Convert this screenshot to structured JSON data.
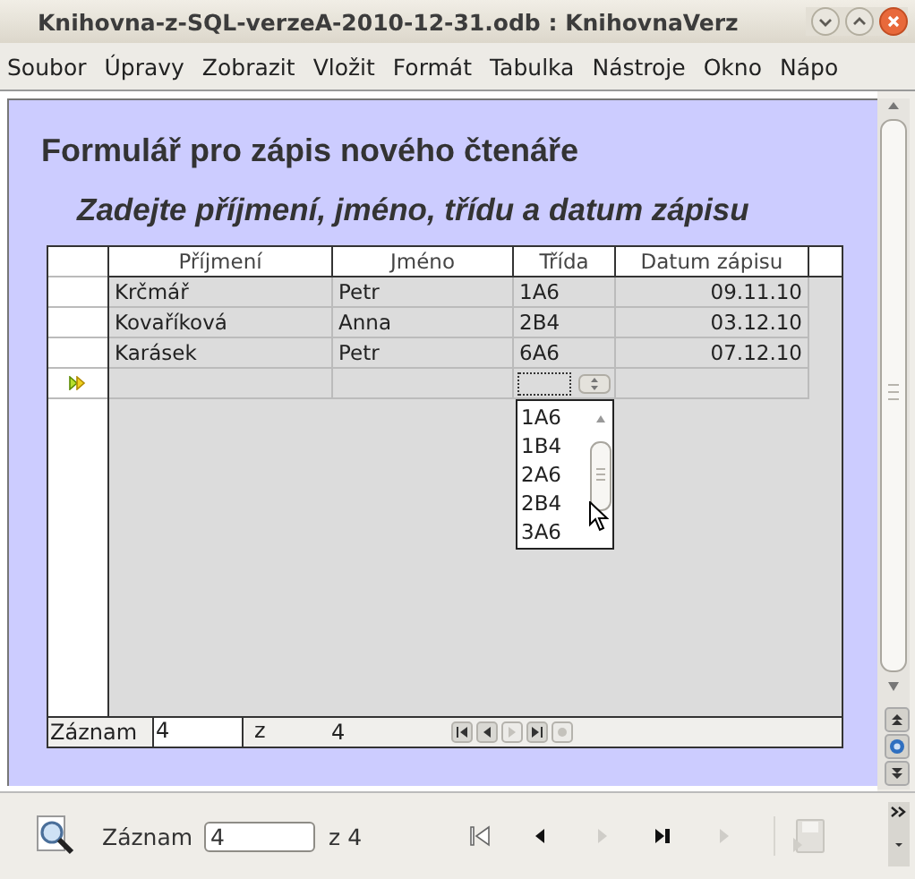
{
  "window": {
    "title": "Knihovna-z-SQL-verzeA-2010-12-31.odb : KnihovnaVerz"
  },
  "menu": [
    "Soubor",
    "Úpravy",
    "Zobrazit",
    "Vložit",
    "Formát",
    "Tabulka",
    "Nástroje",
    "Okno",
    "Nápo"
  ],
  "form": {
    "heading": "Formulář pro zápis nového čtenáře",
    "subheading": "Zadejte příjmení, jméno, třídu a datum zápisu"
  },
  "table": {
    "columns": [
      "Příjmení",
      "Jméno",
      "Třída",
      "Datum zápisu"
    ],
    "rows": [
      {
        "kind": "record",
        "cells": [
          "Krčmář",
          "Petr",
          "1A6",
          "09.11.10"
        ]
      },
      {
        "kind": "record",
        "cells": [
          "Kovaříková",
          "Anna",
          "2B4",
          "03.12.10"
        ]
      },
      {
        "kind": "record",
        "cells": [
          "Karásek",
          "Petr",
          "6A6",
          "07.12.10"
        ]
      },
      {
        "kind": "insert"
      }
    ],
    "dropdown_options": [
      "1A6",
      "1B4",
      "2A6",
      "2B4",
      "3A6"
    ],
    "navigator": {
      "label": "Záznam",
      "value": "4",
      "of": "z",
      "total": "4",
      "buttons": [
        {
          "kind": "first",
          "disabled": false
        },
        {
          "kind": "prev",
          "disabled": false
        },
        {
          "kind": "next",
          "disabled": true
        },
        {
          "kind": "last",
          "disabled": false
        },
        {
          "kind": "new",
          "disabled": true
        }
      ]
    }
  },
  "toolbar": {
    "label": "Záznam",
    "value": "4",
    "of": "z 4",
    "buttons": [
      {
        "kind": "first",
        "disabled": false
      },
      {
        "kind": "prev",
        "disabled": false
      },
      {
        "kind": "next",
        "disabled": true
      },
      {
        "kind": "last",
        "disabled": false
      },
      {
        "kind": "new",
        "disabled": true
      },
      {
        "kind": "save",
        "disabled": true
      }
    ]
  }
}
